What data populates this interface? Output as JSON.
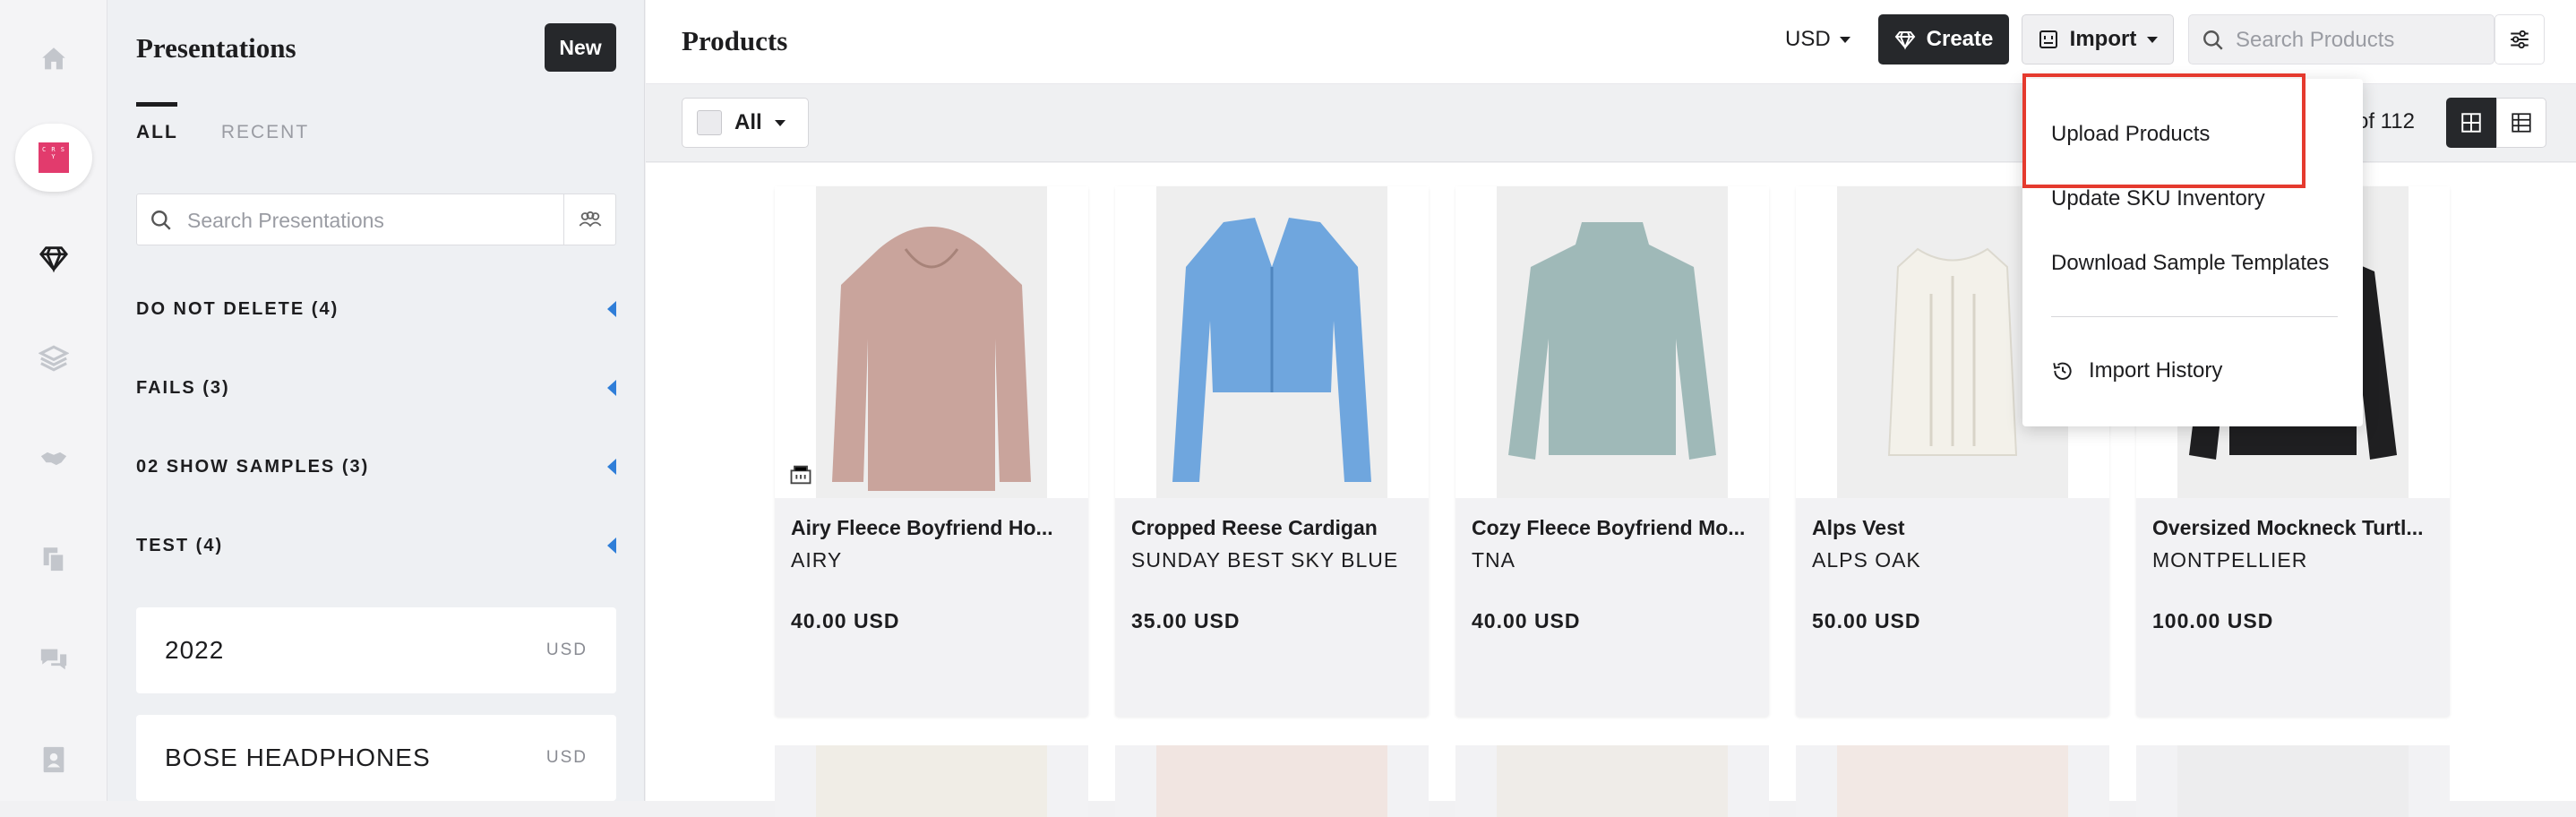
{
  "rail": {
    "items": [
      "home-icon",
      "brand-logo",
      "diamond-icon",
      "layers-icon",
      "handshake-icon",
      "copy-icon",
      "chat-icon",
      "contact-icon"
    ],
    "brand_text": "C R S Y"
  },
  "sidebar": {
    "title": "Presentations",
    "new_label": "New",
    "tabs": [
      {
        "label": "ALL"
      },
      {
        "label": "RECENT"
      }
    ],
    "search_placeholder": "Search Presentations",
    "folders": [
      {
        "label": "DO NOT DELETE (4)"
      },
      {
        "label": "FAILS (3)"
      },
      {
        "label": "02 SHOW SAMPLES (3)"
      },
      {
        "label": "TEST (4)"
      }
    ],
    "presentations": [
      {
        "name": "2022",
        "currency": "USD"
      },
      {
        "name": "BOSE HEADPHONES",
        "currency": "USD"
      }
    ]
  },
  "header": {
    "title": "Products",
    "currency": "USD",
    "create_label": "Create",
    "import_label": "Import",
    "search_placeholder": "Search Products"
  },
  "toolbar": {
    "select_label": "All",
    "count_text": "of 112"
  },
  "import_menu": {
    "items": [
      {
        "label": "Upload Products"
      },
      {
        "label": "Update SKU Inventory"
      },
      {
        "label": "Download Sample Templates"
      }
    ],
    "history_label": "Import History",
    "highlight_color": "#e53a2e"
  },
  "products": [
    {
      "name": "Airy Fleece Boyfriend Ho...",
      "variant": "AIRY",
      "price": "40.00 USD",
      "color": "#c9a49c"
    },
    {
      "name": "Cropped Reese Cardigan",
      "variant": "SUNDAY BEST SKY BLUE",
      "price": "35.00 USD",
      "color": "#6fa6de"
    },
    {
      "name": "Cozy Fleece Boyfriend Mo...",
      "variant": "TNA",
      "price": "40.00 USD",
      "color": "#9fb9b8"
    },
    {
      "name": "Alps Vest",
      "variant": "ALPS OAK",
      "price": "50.00 USD",
      "color": "#f3f1ea"
    },
    {
      "name": "Oversized Mockneck Turtl...",
      "variant": "MONTPELLIER",
      "price": "100.00 USD",
      "color": "#1f1f21"
    }
  ]
}
